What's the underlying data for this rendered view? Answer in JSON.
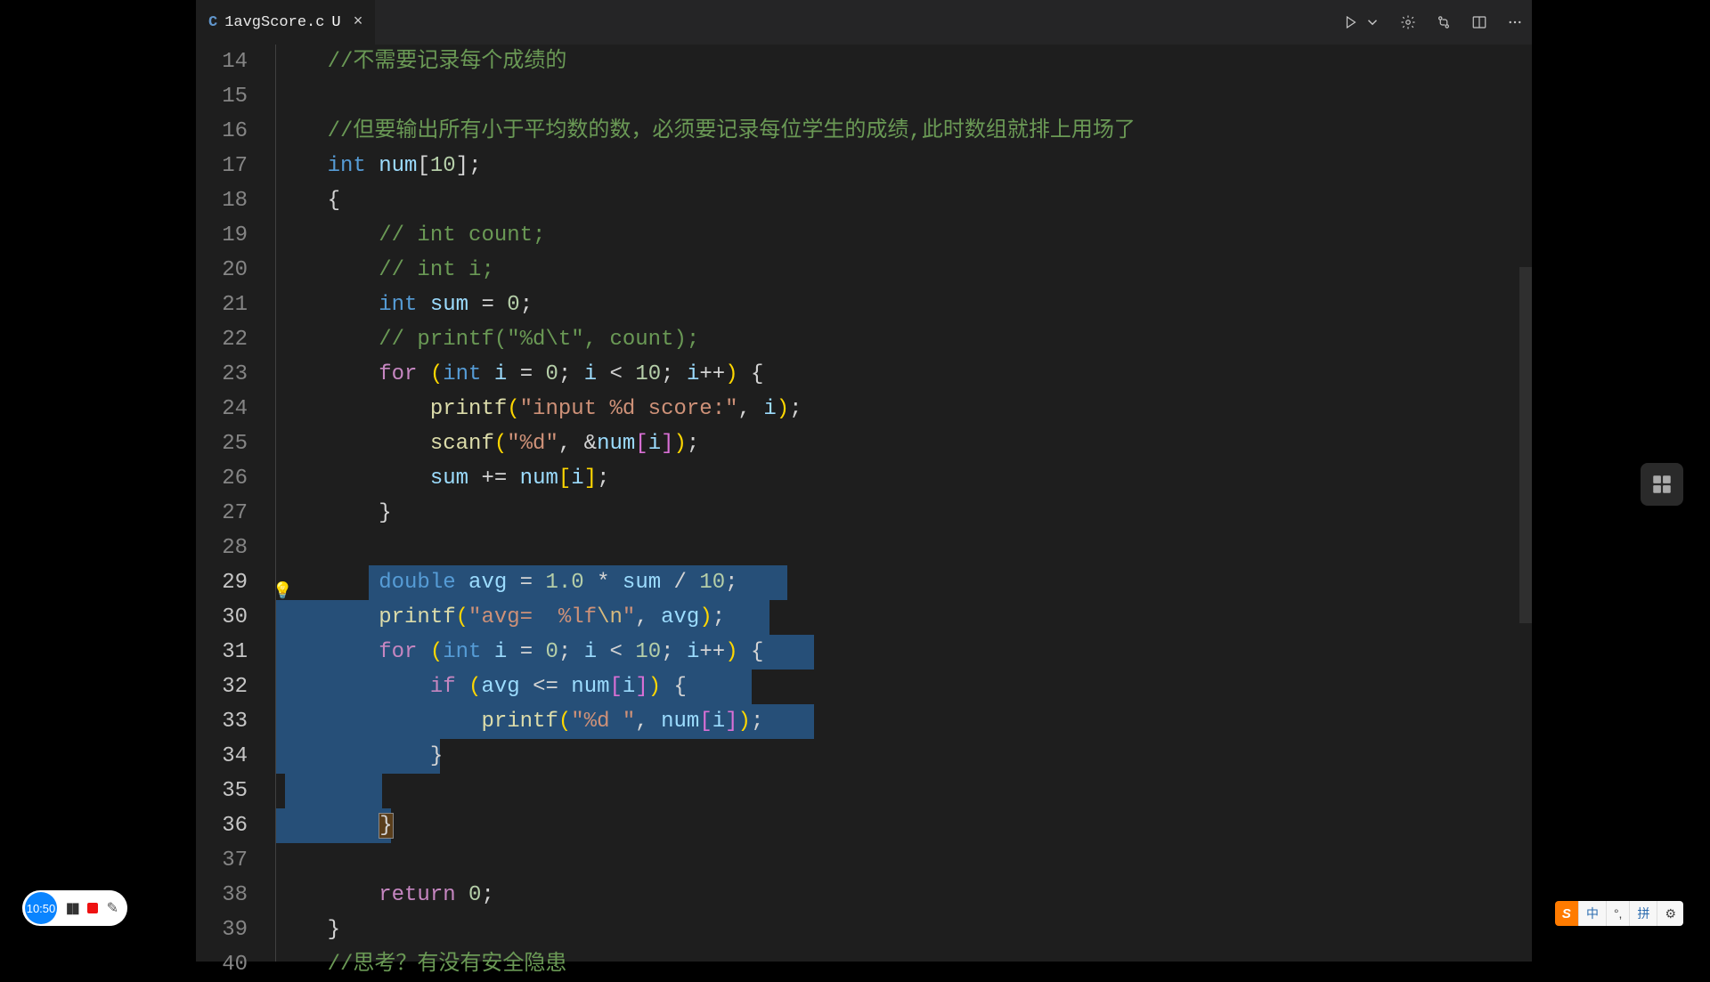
{
  "tab": {
    "lang_badge": "C",
    "filename": "1avgScore.c",
    "modified_marker": "U",
    "close_glyph": "×"
  },
  "recorder": {
    "time": "10:50"
  },
  "ime": {
    "logo": "S",
    "lang": "中",
    "punct": "°,",
    "mode": "拼",
    "settings": "⚙"
  },
  "gutter": {
    "start": 14,
    "lines": [
      "14",
      "15",
      "16",
      "17",
      "18",
      "19",
      "20",
      "21",
      "22",
      "23",
      "24",
      "25",
      "26",
      "27",
      "28",
      "29",
      "30",
      "31",
      "32",
      "33",
      "34",
      "35",
      "36",
      "37",
      "38",
      "39",
      "40"
    ]
  },
  "code": {
    "lines": [
      {
        "n": 14,
        "indent": 1,
        "tokens": [
          [
            "comment",
            "//不需要记录每个成绩的"
          ]
        ]
      },
      {
        "n": 15,
        "indent": 0,
        "tokens": []
      },
      {
        "n": 16,
        "indent": 1,
        "tokens": [
          [
            "comment",
            "//但要输出所有小于平均数的数，必须要记录每位学生的成绩,此时数组就排上用场了"
          ]
        ]
      },
      {
        "n": 17,
        "indent": 1,
        "tokens": [
          [
            "type",
            "int"
          ],
          [
            "sp",
            " "
          ],
          [
            "var",
            "num"
          ],
          [
            "punc",
            "["
          ],
          [
            "num",
            "10"
          ],
          [
            "punc",
            "]"
          ],
          [
            "punc",
            ";"
          ]
        ]
      },
      {
        "n": 18,
        "indent": 1,
        "tokens": [
          [
            "punc",
            "{"
          ]
        ]
      },
      {
        "n": 19,
        "indent": 2,
        "tokens": [
          [
            "comment",
            "// int count;"
          ]
        ]
      },
      {
        "n": 20,
        "indent": 2,
        "tokens": [
          [
            "comment",
            "// int i;"
          ]
        ]
      },
      {
        "n": 21,
        "indent": 2,
        "tokens": [
          [
            "type",
            "int"
          ],
          [
            "sp",
            " "
          ],
          [
            "var",
            "sum"
          ],
          [
            "sp",
            " "
          ],
          [
            "op",
            "="
          ],
          [
            "sp",
            " "
          ],
          [
            "num",
            "0"
          ],
          [
            "punc",
            ";"
          ]
        ]
      },
      {
        "n": 22,
        "indent": 2,
        "tokens": [
          [
            "comment",
            "// printf(\"%d\\t\", count);"
          ]
        ]
      },
      {
        "n": 23,
        "indent": 2,
        "tokens": [
          [
            "ctrl",
            "for"
          ],
          [
            "sp",
            " "
          ],
          [
            "paren1",
            "("
          ],
          [
            "type",
            "int"
          ],
          [
            "sp",
            " "
          ],
          [
            "var",
            "i"
          ],
          [
            "sp",
            " "
          ],
          [
            "op",
            "="
          ],
          [
            "sp",
            " "
          ],
          [
            "num",
            "0"
          ],
          [
            "punc",
            ";"
          ],
          [
            "sp",
            " "
          ],
          [
            "var",
            "i"
          ],
          [
            "sp",
            " "
          ],
          [
            "op",
            "<"
          ],
          [
            "sp",
            " "
          ],
          [
            "num",
            "10"
          ],
          [
            "punc",
            ";"
          ],
          [
            "sp",
            " "
          ],
          [
            "var",
            "i"
          ],
          [
            "op",
            "++"
          ],
          [
            "paren1",
            ")"
          ],
          [
            "sp",
            " "
          ],
          [
            "punc",
            "{"
          ]
        ]
      },
      {
        "n": 24,
        "indent": 3,
        "tokens": [
          [
            "func",
            "printf"
          ],
          [
            "paren1",
            "("
          ],
          [
            "string",
            "\"input %d score:\""
          ],
          [
            "punc",
            ","
          ],
          [
            "sp",
            " "
          ],
          [
            "var",
            "i"
          ],
          [
            "paren1",
            ")"
          ],
          [
            "punc",
            ";"
          ]
        ]
      },
      {
        "n": 25,
        "indent": 3,
        "tokens": [
          [
            "func",
            "scanf"
          ],
          [
            "paren1",
            "("
          ],
          [
            "string",
            "\"%d\""
          ],
          [
            "punc",
            ","
          ],
          [
            "sp",
            " "
          ],
          [
            "op",
            "&"
          ],
          [
            "var",
            "num"
          ],
          [
            "paren2",
            "["
          ],
          [
            "var",
            "i"
          ],
          [
            "paren2",
            "]"
          ],
          [
            "paren1",
            ")"
          ],
          [
            "punc",
            ";"
          ]
        ]
      },
      {
        "n": 26,
        "indent": 3,
        "tokens": [
          [
            "var",
            "sum"
          ],
          [
            "sp",
            " "
          ],
          [
            "op",
            "+="
          ],
          [
            "sp",
            " "
          ],
          [
            "var",
            "num"
          ],
          [
            "paren1",
            "["
          ],
          [
            "var",
            "i"
          ],
          [
            "paren1",
            "]"
          ],
          [
            "punc",
            ";"
          ]
        ]
      },
      {
        "n": 27,
        "indent": 2,
        "tokens": [
          [
            "punc",
            "}"
          ]
        ]
      },
      {
        "n": 28,
        "indent": 0,
        "tokens": []
      },
      {
        "n": 29,
        "indent": 2,
        "sel": [
          110,
          580
        ],
        "tokens": [
          [
            "type",
            "double"
          ],
          [
            "sp",
            " "
          ],
          [
            "var",
            "avg"
          ],
          [
            "sp",
            " "
          ],
          [
            "op",
            "="
          ],
          [
            "sp",
            " "
          ],
          [
            "num",
            "1.0"
          ],
          [
            "sp",
            " "
          ],
          [
            "op",
            "*"
          ],
          [
            "sp",
            " "
          ],
          [
            "var",
            "sum"
          ],
          [
            "sp",
            " "
          ],
          [
            "op",
            "/"
          ],
          [
            "sp",
            " "
          ],
          [
            "num",
            "10"
          ],
          [
            "punc",
            ";"
          ]
        ]
      },
      {
        "n": 30,
        "indent": 2,
        "sel": [
          6,
          560
        ],
        "tokens": [
          [
            "func",
            "printf"
          ],
          [
            "paren1",
            "("
          ],
          [
            "string",
            "\"avg=  %lf"
          ],
          [
            "esc",
            "\\n"
          ],
          [
            "string",
            "\""
          ],
          [
            "punc",
            ","
          ],
          [
            "sp",
            " "
          ],
          [
            "var",
            "avg"
          ],
          [
            "paren1",
            ")"
          ],
          [
            "punc",
            ";"
          ]
        ]
      },
      {
        "n": 31,
        "indent": 2,
        "sel": [
          6,
          610
        ],
        "tokens": [
          [
            "ctrl",
            "for"
          ],
          [
            "sp",
            " "
          ],
          [
            "paren1",
            "("
          ],
          [
            "type",
            "int"
          ],
          [
            "sp",
            " "
          ],
          [
            "var",
            "i"
          ],
          [
            "sp",
            " "
          ],
          [
            "op",
            "="
          ],
          [
            "sp",
            " "
          ],
          [
            "num",
            "0"
          ],
          [
            "punc",
            ";"
          ],
          [
            "sp",
            " "
          ],
          [
            "var",
            "i"
          ],
          [
            "sp",
            " "
          ],
          [
            "op",
            "<"
          ],
          [
            "sp",
            " "
          ],
          [
            "num",
            "10"
          ],
          [
            "punc",
            ";"
          ],
          [
            "sp",
            " "
          ],
          [
            "var",
            "i"
          ],
          [
            "op",
            "++"
          ],
          [
            "paren1",
            ")"
          ],
          [
            "sp",
            " "
          ],
          [
            "punc",
            "{"
          ]
        ]
      },
      {
        "n": 32,
        "indent": 3,
        "sel": [
          6,
          540
        ],
        "tokens": [
          [
            "ctrl",
            "if"
          ],
          [
            "sp",
            " "
          ],
          [
            "paren1",
            "("
          ],
          [
            "var",
            "avg"
          ],
          [
            "sp",
            " "
          ],
          [
            "op",
            "<="
          ],
          [
            "sp",
            " "
          ],
          [
            "var",
            "num"
          ],
          [
            "paren2",
            "["
          ],
          [
            "var",
            "i"
          ],
          [
            "paren2",
            "]"
          ],
          [
            "paren1",
            ")"
          ],
          [
            "sp",
            " "
          ],
          [
            "punc",
            "{"
          ]
        ]
      },
      {
        "n": 33,
        "indent": 4,
        "sel": [
          6,
          610
        ],
        "tokens": [
          [
            "func",
            "printf"
          ],
          [
            "paren1",
            "("
          ],
          [
            "string",
            "\"%d \""
          ],
          [
            "punc",
            ","
          ],
          [
            "sp",
            " "
          ],
          [
            "var",
            "num"
          ],
          [
            "paren2",
            "["
          ],
          [
            "var",
            "i"
          ],
          [
            "paren2",
            "]"
          ],
          [
            "paren1",
            ")"
          ],
          [
            "punc",
            ";"
          ]
        ]
      },
      {
        "n": 34,
        "indent": 3,
        "sel": [
          6,
          190
        ],
        "tokens": [
          [
            "punc",
            "}"
          ]
        ]
      },
      {
        "n": 35,
        "indent": 0,
        "sel": [
          16,
          125
        ],
        "tokens": []
      },
      {
        "n": 36,
        "indent": 2,
        "sel": [
          6,
          135
        ],
        "bracematch": true,
        "tokens": [
          [
            "punc",
            "}"
          ]
        ]
      },
      {
        "n": 37,
        "indent": 0,
        "tokens": []
      },
      {
        "n": 38,
        "indent": 2,
        "tokens": [
          [
            "ctrl",
            "return"
          ],
          [
            "sp",
            " "
          ],
          [
            "num",
            "0"
          ],
          [
            "punc",
            ";"
          ]
        ]
      },
      {
        "n": 39,
        "indent": 1,
        "tokens": [
          [
            "punc",
            "}"
          ]
        ]
      },
      {
        "n": 40,
        "indent": 1,
        "tokens": [
          [
            "comment",
            "//思考？有没有安全隐患"
          ]
        ]
      }
    ]
  }
}
